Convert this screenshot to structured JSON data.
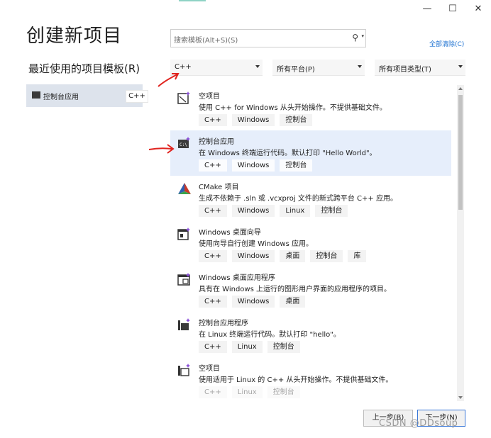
{
  "window": {
    "minimize_glyph": "—",
    "maximize_glyph": "☐",
    "close_glyph": "✕"
  },
  "header": {
    "title": "创建新项目",
    "recent_title": "最近使用的项目模板(R)"
  },
  "recent_items": [
    {
      "label": "控制台应用",
      "tag": "C++",
      "icon": "console-app-icon"
    }
  ],
  "search": {
    "placeholder": "搜索模板(Alt+S)(S)",
    "icon": "search-icon"
  },
  "clear_all_label": "全部清除(C)",
  "filters": {
    "language": "C++",
    "platform": "所有平台(P)",
    "project_type": "所有项目类型(T)"
  },
  "templates": [
    {
      "name": "空项目",
      "desc": "使用 C++ for Windows 从头开始操作。不提供基础文件。",
      "tags": [
        "C++",
        "Windows",
        "控制台"
      ],
      "icon": "empty-project-icon",
      "selected": false
    },
    {
      "name": "控制台应用",
      "desc": "在 Windows 终端运行代码。默认打印 \"Hello World\"。",
      "tags": [
        "C++",
        "Windows",
        "控制台"
      ],
      "icon": "console-app-icon",
      "selected": true
    },
    {
      "name": "CMake 项目",
      "desc": "生成不依赖于 .sln 或 .vcxproj 文件的新式跨平台 C++ 应用。",
      "tags": [
        "C++",
        "Windows",
        "Linux",
        "控制台"
      ],
      "icon": "cmake-icon",
      "selected": false
    },
    {
      "name": "Windows 桌面向导",
      "desc": "使用向导自行创建 Windows 应用。",
      "tags": [
        "C++",
        "Windows",
        "桌面",
        "控制台",
        "库"
      ],
      "icon": "desktop-wizard-icon",
      "selected": false
    },
    {
      "name": "Windows 桌面应用程序",
      "desc": "具有在 Windows 上运行的图形用户界面的应用程序的项目。",
      "tags": [
        "C++",
        "Windows",
        "桌面"
      ],
      "icon": "desktop-app-icon",
      "selected": false
    },
    {
      "name": "控制台应用程序",
      "desc": "在 Linux 终端运行代码。默认打印 \"hello\"。",
      "tags": [
        "C++",
        "Linux",
        "控制台"
      ],
      "icon": "linux-console-icon",
      "selected": false
    },
    {
      "name": "空项目",
      "desc": "使用适用于 Linux 的 C++ 从头开始操作。不提供基础文件。",
      "tags": [
        "C++",
        "Linux",
        "控制台"
      ],
      "icon": "linux-empty-project-icon",
      "selected": false
    }
  ],
  "buttons": {
    "back": "上一步(B)",
    "next": "下一步(N)"
  },
  "watermark": "CSDN @DDsoup",
  "colors": {
    "accent": "#1a6fd0",
    "selected_bg": "#e6eefb",
    "annotation_red": "#e0231e"
  }
}
